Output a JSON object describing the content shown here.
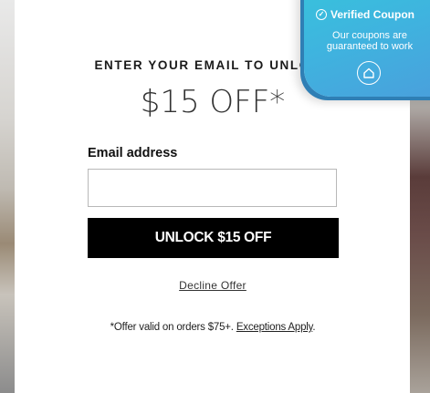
{
  "modal": {
    "headline": "ENTER YOUR EMAIL TO UNLOCK",
    "offer": "$15 OFF*",
    "email_label": "Email address",
    "email_value": "",
    "email_placeholder": "",
    "unlock_button": "UNLOCK $15 OFF",
    "decline_link": "Decline Offer",
    "fineprint_text": "*Offer valid on orders $75+.",
    "fineprint_link": "Exceptions Apply",
    "fineprint_end": "."
  },
  "badge": {
    "title": "Verified Coupon",
    "subtitle": "Our coupons are guaranteed to work",
    "check_icon": "check-circle-icon",
    "logo_icon": "home-shield-icon"
  },
  "colors": {
    "button_bg": "#000000",
    "badge_bg": "#3fb3df"
  }
}
